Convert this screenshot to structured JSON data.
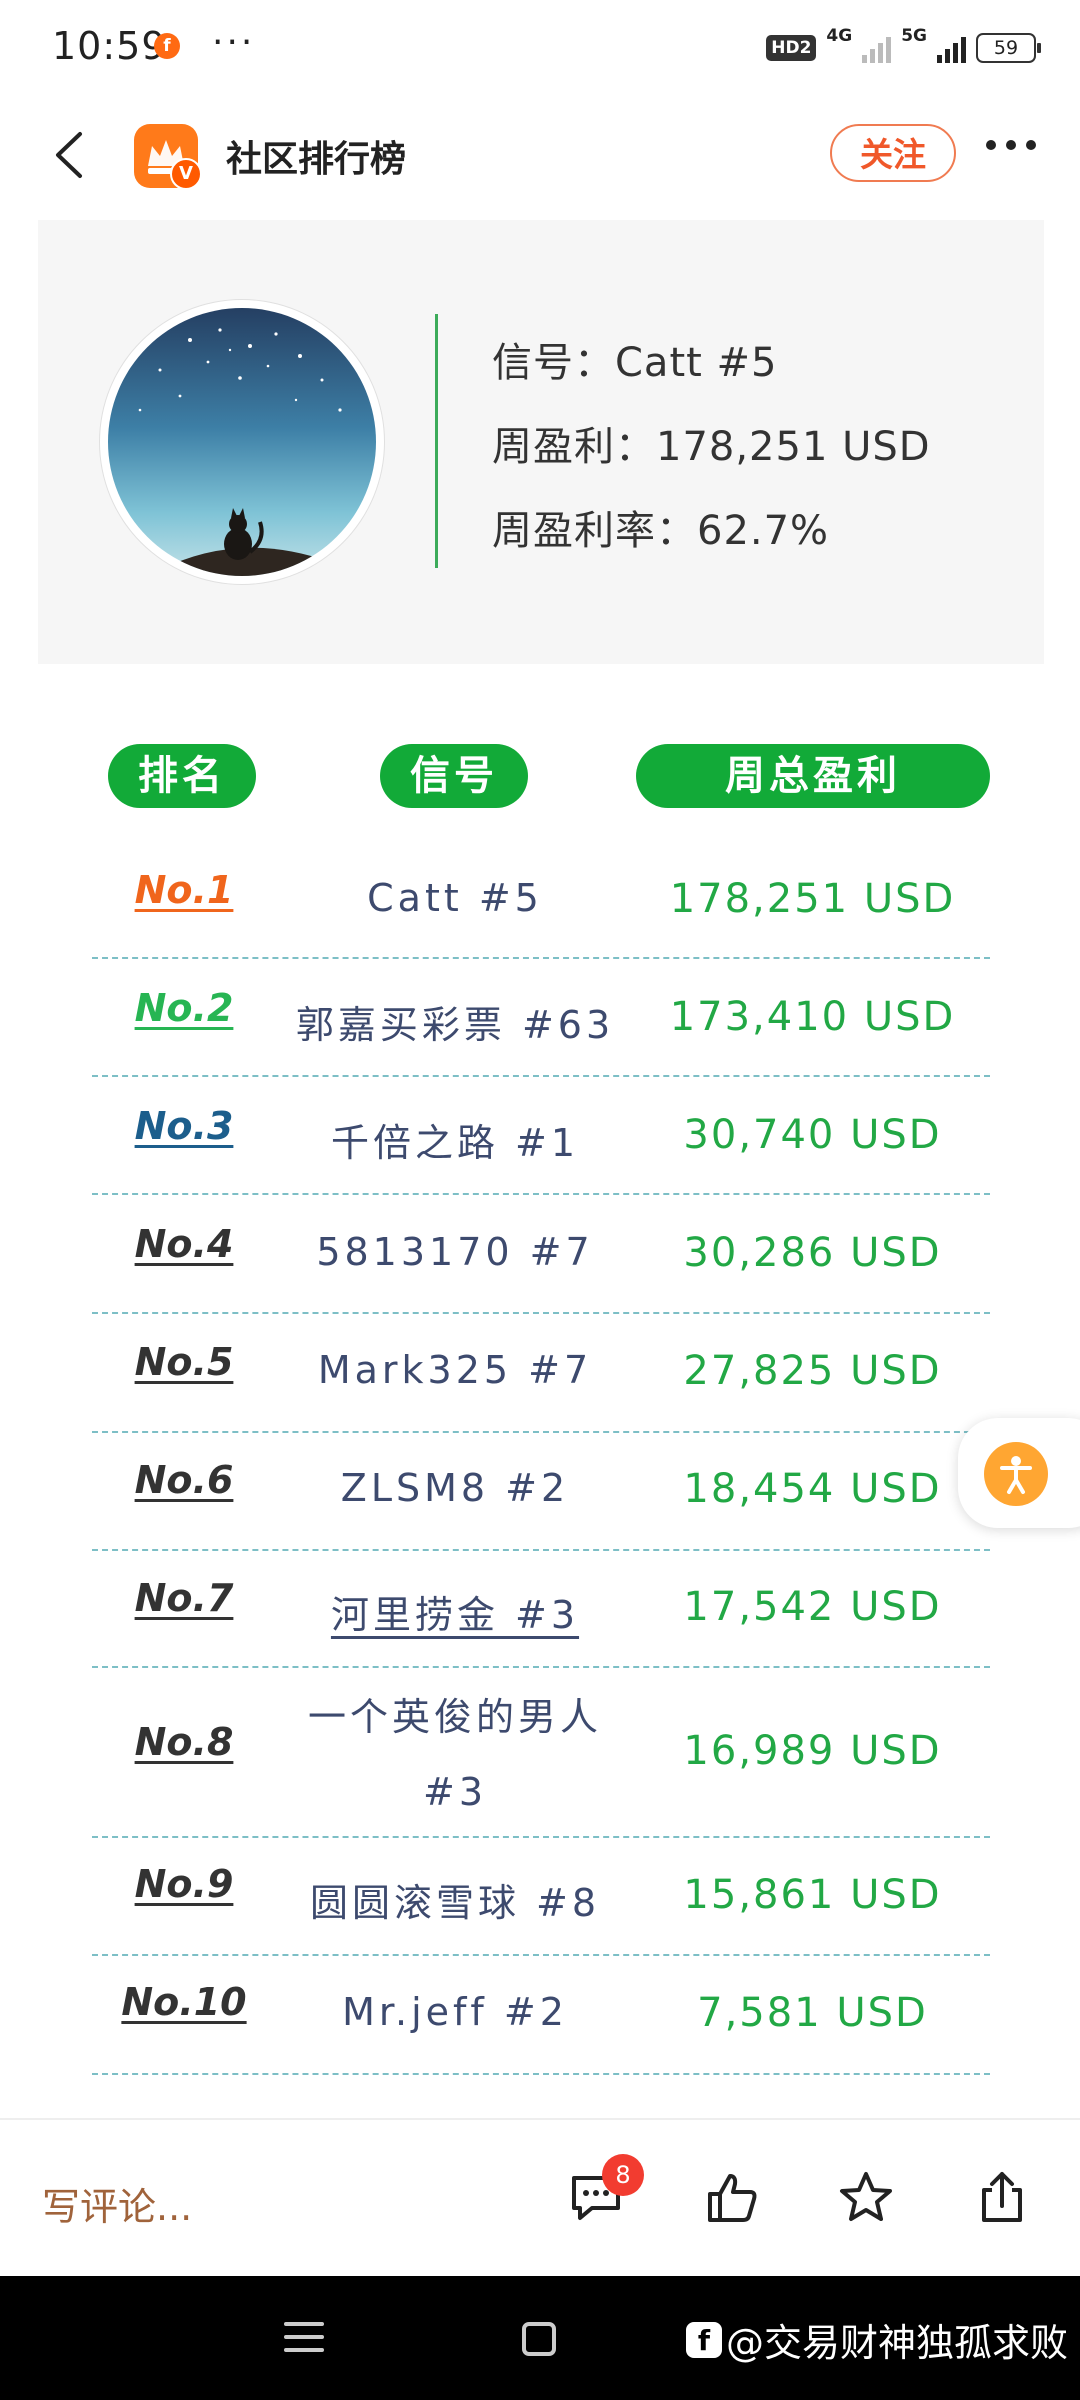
{
  "status_bar": {
    "time": "10:59",
    "app_icon": "f",
    "dots": "···",
    "hd": "HD2",
    "net1": "4G",
    "net2": "5G",
    "battery": "59"
  },
  "header": {
    "title": "社区排行榜",
    "follow_label": "关注",
    "avatar_badge": "V"
  },
  "profile": {
    "signal_line": "信号：Catt #5",
    "weekly_profit_line": "周盈利：178,251 USD",
    "weekly_rate_line": "周盈利率：62.7%"
  },
  "table": {
    "headers": [
      "排名",
      "信号",
      "周总盈利"
    ],
    "rows": [
      {
        "rank": "No.1",
        "name": "Catt #5",
        "profit": "178,251 USD"
      },
      {
        "rank": "No.2",
        "name": "郭嘉买彩票 #63",
        "profit": "173,410 USD"
      },
      {
        "rank": "No.3",
        "name": "千倍之路 #1",
        "profit": "30,740 USD"
      },
      {
        "rank": "No.4",
        "name": "5813170 #7",
        "profit": "30,286 USD"
      },
      {
        "rank": "No.5",
        "name": "Mark325 #7",
        "profit": "27,825 USD"
      },
      {
        "rank": "No.6",
        "name": "ZLSM8 #2",
        "profit": "18,454 USD"
      },
      {
        "rank": "No.7",
        "name": "河里捞金 #3",
        "profit": "17,542 USD"
      },
      {
        "rank": "No.8",
        "name_line1": "一个英俊的男人",
        "name_line2": "#3",
        "profit": "16,989 USD"
      },
      {
        "rank": "No.9",
        "name": "圆圆滚雪球 #8",
        "profit": "15,861 USD"
      },
      {
        "rank": "No.10",
        "name": "Mr.jeff #2",
        "profit": "7,581 USD"
      }
    ]
  },
  "colors": {
    "rank1": "#f0651c",
    "rank2": "#27b553",
    "rank3": "#1c5e8c",
    "rank_other": "#333333",
    "header_green": "#12aa38",
    "profit_green": "#22a845"
  },
  "bottom": {
    "comment_placeholder": "写评论...",
    "comment_count": "8"
  },
  "watermark": {
    "logo": "f",
    "text": "@交易财神独孤求败"
  }
}
